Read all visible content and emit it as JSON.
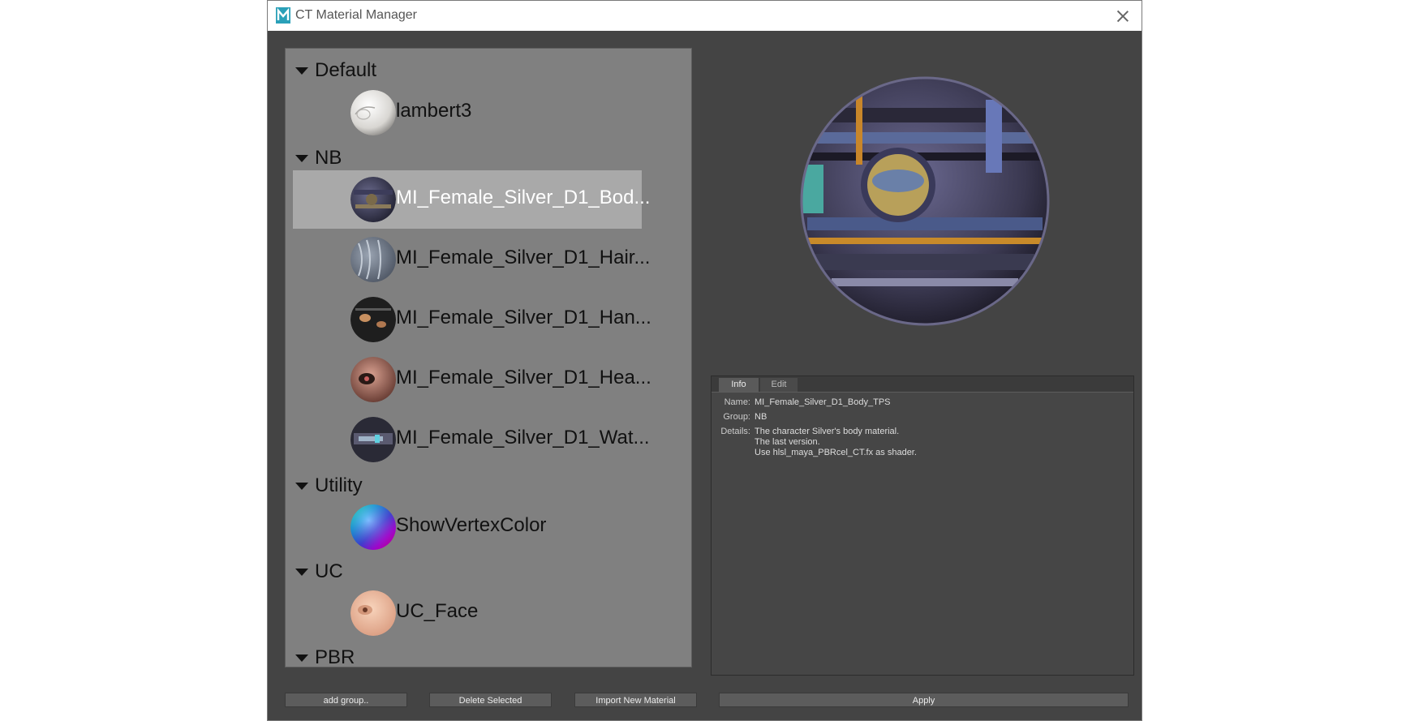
{
  "window": {
    "title": "CT Material Manager"
  },
  "groups": [
    {
      "name": "Default",
      "materials": [
        {
          "name": "lambert3",
          "icon": "white-sphere-icon"
        }
      ]
    },
    {
      "name": "NB",
      "materials": [
        {
          "name": "MI_Female_Silver_D1_Bod...",
          "icon": "body-sphere-icon",
          "selected": true
        },
        {
          "name": "MI_Female_Silver_D1_Hair...",
          "icon": "hair-sphere-icon"
        },
        {
          "name": "MI_Female_Silver_D1_Han...",
          "icon": "hand-sphere-icon"
        },
        {
          "name": "MI_Female_Silver_D1_Hea...",
          "icon": "head-sphere-icon"
        },
        {
          "name": "MI_Female_Silver_D1_Wat...",
          "icon": "watch-sphere-icon"
        }
      ]
    },
    {
      "name": "Utility",
      "materials": [
        {
          "name": "ShowVertexColor",
          "icon": "rainbow-sphere-icon"
        }
      ]
    },
    {
      "name": "UC",
      "materials": [
        {
          "name": "UC_Face",
          "icon": "skin-sphere-icon"
        }
      ]
    },
    {
      "name": "PBR",
      "materials": []
    }
  ],
  "info": {
    "tabs": [
      "Info",
      "Edit"
    ],
    "active_tab": "Info",
    "name_label": "Name:",
    "name_value": "MI_Female_Silver_D1_Body_TPS",
    "group_label": "Group:",
    "group_value": "NB",
    "details_label": "Details:",
    "details_lines": [
      "The character Silver's body material.",
      "The last version.",
      "Use hlsl_maya_PBRcel_CT.fx as shader."
    ]
  },
  "buttons": {
    "add_group": "add group..",
    "delete_selected": "Delete Selected",
    "import_new": "Import New Material",
    "apply": "Apply"
  },
  "colors": {
    "window_bg": "#444444",
    "list_bg": "#808080",
    "selection": "#a9a9a9",
    "app_logo": "#2aa0b8"
  }
}
